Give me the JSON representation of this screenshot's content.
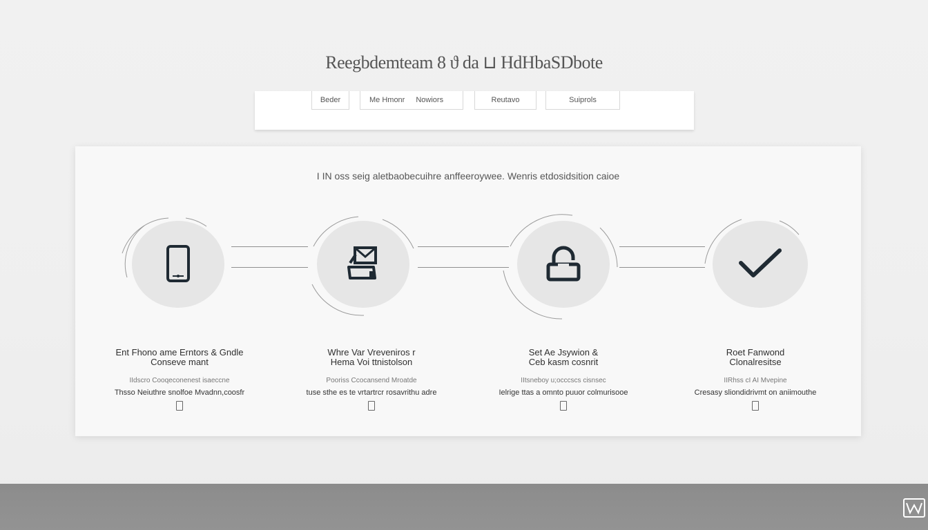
{
  "header": {
    "title": "Reegbdemteam 8 ϑ da ⊔ HdHbaSDbote"
  },
  "tabs": [
    {
      "label": "Beder"
    },
    {
      "label": "Me Hmonr"
    },
    {
      "label": "Nowiors"
    },
    {
      "label": "Reutavo"
    },
    {
      "label": "Suiprols"
    }
  ],
  "card": {
    "subtitle": "I IN oss seig aletbaobecuihre anffeeroywee. Wenris etdosidsition caioe",
    "steps": [
      {
        "icon": "phone-icon",
        "title": "Ent Fhono ame Erntors & Gndle",
        "title2": "Conseve mant",
        "caption": "IIdscro Cooqeconenest isaeccne",
        "desc": "Thsso Neiuthre snolfoe Mvadnn,coosfr"
      },
      {
        "icon": "mail-device-icon",
        "title": "Whre Var Vreveniros r",
        "title2": "Hema Voi ttnistolson",
        "caption": "Pooriss Ccocansend Mroatde",
        "desc": "tuse sthe es te vrtartrcr rosavrithu adre"
      },
      {
        "icon": "unlock-icon",
        "title": "Set Ae Jsywion &",
        "title2": "Ceb kasm cosnrit",
        "caption": "IItsneboy u;occcscs cisnsec",
        "desc": "Ielrige ttas a omnto puuor colmurisooe"
      },
      {
        "icon": "checkmark-icon",
        "title": "Roet Fanwond",
        "title2": "Clonalresitse",
        "caption": "IIRhss cI AI Mvepine",
        "desc": "Cresasy sliondidrivmt on aniimouthe"
      }
    ]
  },
  "colors": {
    "background": "#f0f0f0",
    "circle": "#e6e6e6",
    "icon": "#1f2a33",
    "footer": "#8f8f8f"
  }
}
